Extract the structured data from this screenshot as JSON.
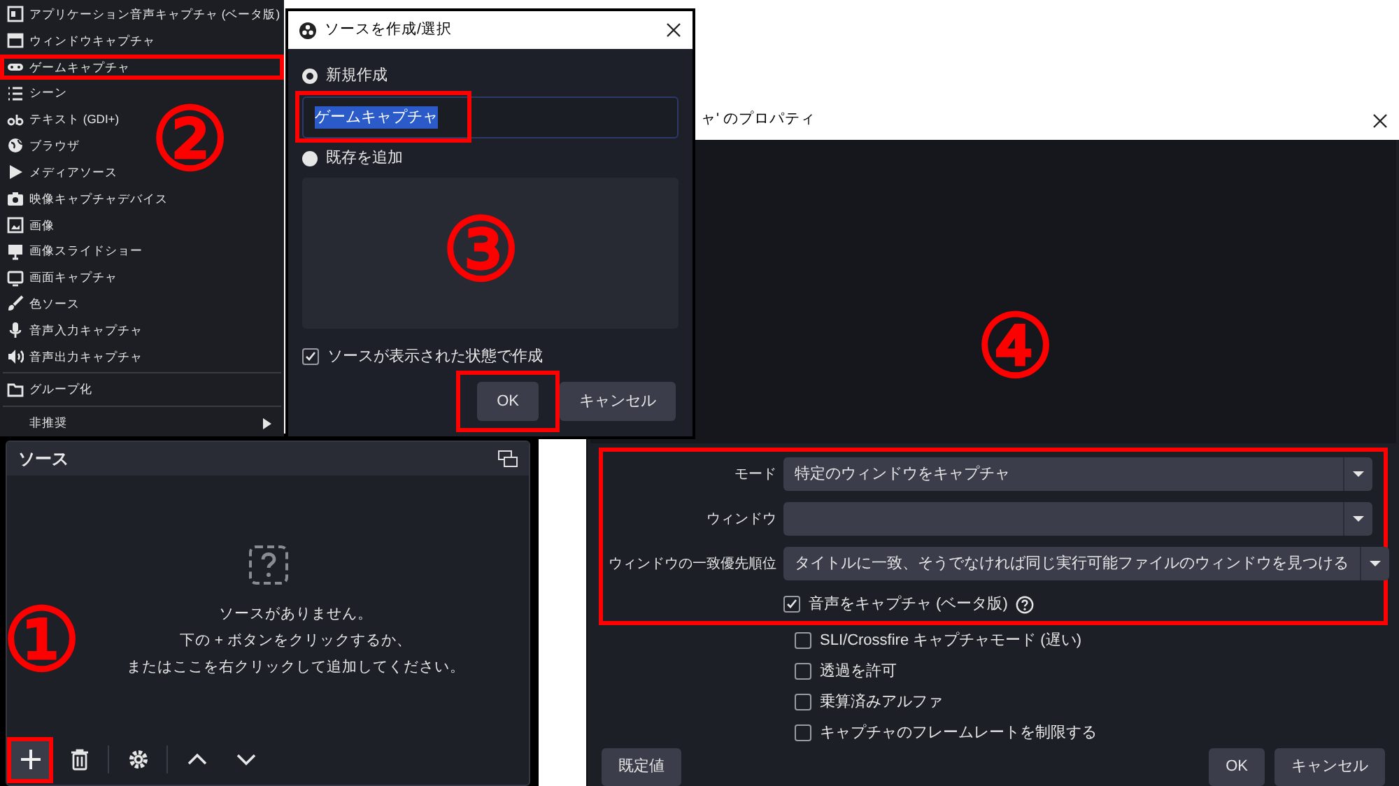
{
  "source_menu": {
    "step_label": "②",
    "items": [
      {
        "kind": "item",
        "label": "アプリケーション音声キャプチャ (ベータ版)",
        "highlighted": false
      },
      {
        "kind": "item",
        "label": "ウィンドウキャプチャ",
        "highlighted": false
      },
      {
        "kind": "item",
        "label": "ゲームキャプチャ",
        "highlighted": true
      },
      {
        "kind": "item",
        "label": "シーン",
        "highlighted": false
      },
      {
        "kind": "item",
        "label": "テキスト (GDI+)",
        "highlighted": false
      },
      {
        "kind": "item",
        "label": "ブラウザ",
        "highlighted": false
      },
      {
        "kind": "item",
        "label": "メディアソース",
        "highlighted": false
      },
      {
        "kind": "item",
        "label": "映像キャプチャデバイス",
        "highlighted": false
      },
      {
        "kind": "item",
        "label": "画像",
        "highlighted": false
      },
      {
        "kind": "item",
        "label": "画像スライドショー",
        "highlighted": false
      },
      {
        "kind": "item",
        "label": "画面キャプチャ",
        "highlighted": false
      },
      {
        "kind": "item",
        "label": "色ソース",
        "highlighted": false
      },
      {
        "kind": "item",
        "label": "音声入力キャプチャ",
        "highlighted": false
      },
      {
        "kind": "item",
        "label": "音声出力キャプチャ",
        "highlighted": false
      },
      {
        "kind": "separator"
      },
      {
        "kind": "item",
        "label": "グループ化",
        "highlighted": false
      },
      {
        "kind": "separator"
      },
      {
        "kind": "submenu",
        "label": "非推奨",
        "highlighted": false
      }
    ]
  },
  "create_dialog": {
    "title": "ソースを作成/選択",
    "step_label": "③",
    "options": [
      {
        "label": "新規作成",
        "selected": true
      },
      {
        "label": "既存を追加",
        "selected": false
      }
    ],
    "name_field": {
      "value": "ゲームキャプチャ",
      "text_selected": true,
      "highlighted": true
    },
    "visible_checkbox": {
      "label": "ソースが表示された状態で作成",
      "checked": true
    },
    "buttons": [
      {
        "label": "OK",
        "highlighted": true
      },
      {
        "label": "キャンセル",
        "highlighted": false
      }
    ]
  },
  "properties_window": {
    "title": "ャ' のプロパティ",
    "step_label": "④",
    "settings_group": {
      "highlighted": true,
      "fields": [
        {
          "label": "モード",
          "value": "特定のウィンドウをキャプチャ"
        },
        {
          "label": "ウィンドウ"
        },
        {
          "label": "ウィンドウの一致優先順位",
          "value": "タイトルに一致、そうでなければ同じ実行可能ファイルのウィンドウを見つける"
        }
      ],
      "checkboxes": [
        {
          "label": "音声をキャプチャ (ベータ版)",
          "checked": true,
          "help": true
        }
      ]
    },
    "checkboxes": [
      {
        "label": "SLI/Crossfire キャプチャモード (遅い)",
        "checked": false,
        "help": false
      },
      {
        "label": "透過を許可",
        "checked": false,
        "help": false
      },
      {
        "label": "乗算済みアルファ",
        "checked": false,
        "help": false
      },
      {
        "label": "キャプチャのフレームレートを制限する",
        "checked": false,
        "help": false
      }
    ],
    "buttons": [
      {
        "label": "既定値"
      },
      {
        "label": "OK"
      },
      {
        "label": "キャンセル"
      }
    ]
  },
  "sources_panel": {
    "title": "ソース",
    "step_label": "①",
    "empty_message_lines": [
      "ソースがありません。",
      "下の + ボタンをクリックするか、",
      "またはここを右クリックして追加してください。"
    ],
    "toolbar": [
      {
        "kind": "add",
        "highlighted": true
      },
      {
        "kind": "remove",
        "highlighted": false
      },
      {
        "kind": "properties",
        "highlighted": false
      },
      {
        "kind": "move-up",
        "highlighted": false
      },
      {
        "kind": "move-down",
        "highlighted": false
      }
    ]
  }
}
